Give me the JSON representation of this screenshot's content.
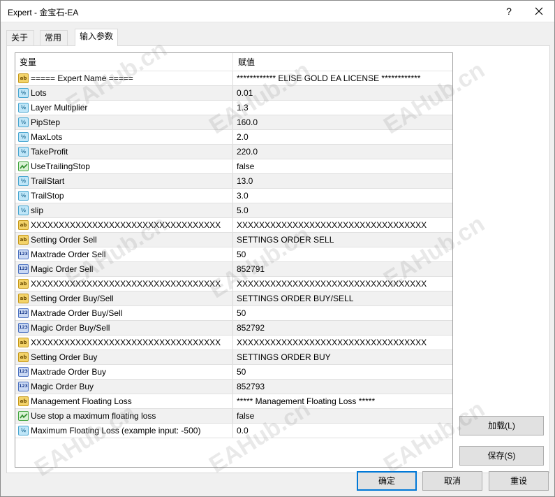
{
  "window": {
    "title": "Expert - 金宝石-EA",
    "help_glyph": "?"
  },
  "tabs": [
    {
      "label": "关于"
    },
    {
      "label": "常用"
    },
    {
      "label": "输入参数",
      "active": true
    }
  ],
  "grid": {
    "headers": {
      "variable": "变量",
      "value": "赋值"
    },
    "rows": [
      {
        "type": "ab",
        "icon": "string-type-icon",
        "name": "===== Expert Name =====",
        "value": "************ ELISE GOLD EA LICENSE ************"
      },
      {
        "type": "dbl",
        "icon": "double-type-icon",
        "name": "Lots",
        "value": "0.01"
      },
      {
        "type": "dbl",
        "icon": "double-type-icon",
        "name": "Layer Multiplier",
        "value": "1.3"
      },
      {
        "type": "dbl",
        "icon": "double-type-icon",
        "name": "PipStep",
        "value": "160.0"
      },
      {
        "type": "dbl",
        "icon": "double-type-icon",
        "name": "MaxLots",
        "value": "2.0"
      },
      {
        "type": "dbl",
        "icon": "double-type-icon",
        "name": "TakeProfit",
        "value": "220.0"
      },
      {
        "type": "bool",
        "icon": "bool-type-icon",
        "name": "UseTrailingStop",
        "value": "false"
      },
      {
        "type": "dbl",
        "icon": "double-type-icon",
        "name": "TrailStart",
        "value": "13.0"
      },
      {
        "type": "dbl",
        "icon": "double-type-icon",
        "name": "TrailStop",
        "value": "3.0"
      },
      {
        "type": "dbl",
        "icon": "double-type-icon",
        "name": "slip",
        "value": "5.0"
      },
      {
        "type": "ab",
        "icon": "string-type-icon",
        "name": "XXXXXXXXXXXXXXXXXXXXXXXXXXXXXXXXXX",
        "value": "XXXXXXXXXXXXXXXXXXXXXXXXXXXXXXXXXX"
      },
      {
        "type": "ab",
        "icon": "string-type-icon",
        "name": "Setting Order Sell",
        "value": "SETTINGS ORDER SELL"
      },
      {
        "type": "int",
        "icon": "integer-type-icon",
        "name": "Maxtrade Order Sell",
        "value": "50"
      },
      {
        "type": "int",
        "icon": "integer-type-icon",
        "name": "Magic Order Sell",
        "value": "852791"
      },
      {
        "type": "ab",
        "icon": "string-type-icon",
        "name": "XXXXXXXXXXXXXXXXXXXXXXXXXXXXXXXXXX",
        "value": "XXXXXXXXXXXXXXXXXXXXXXXXXXXXXXXXXX"
      },
      {
        "type": "ab",
        "icon": "string-type-icon",
        "name": "Setting Order Buy/Sell",
        "value": "SETTINGS ORDER BUY/SELL"
      },
      {
        "type": "int",
        "icon": "integer-type-icon",
        "name": "Maxtrade Order Buy/Sell",
        "value": "50"
      },
      {
        "type": "int",
        "icon": "integer-type-icon",
        "name": "Magic Order Buy/Sell",
        "value": "852792"
      },
      {
        "type": "ab",
        "icon": "string-type-icon",
        "name": "XXXXXXXXXXXXXXXXXXXXXXXXXXXXXXXXXX",
        "value": "XXXXXXXXXXXXXXXXXXXXXXXXXXXXXXXXXX"
      },
      {
        "type": "ab",
        "icon": "string-type-icon",
        "name": "Setting Order Buy",
        "value": "SETTINGS ORDER BUY"
      },
      {
        "type": "int",
        "icon": "integer-type-icon",
        "name": "Maxtrade Order Buy",
        "value": "50"
      },
      {
        "type": "int",
        "icon": "integer-type-icon",
        "name": "Magic Order Buy",
        "value": "852793"
      },
      {
        "type": "ab",
        "icon": "string-type-icon",
        "name": "Management Floating Loss",
        "value": "***** Management Floating Loss *****"
      },
      {
        "type": "bool",
        "icon": "bool-type-icon",
        "name": "Use stop a maximum floating loss",
        "value": "false"
      },
      {
        "type": "dbl",
        "icon": "double-type-icon",
        "name": "Maximum Floating Loss (example input: -500)",
        "value": "0.0"
      }
    ]
  },
  "icon_glyphs": {
    "ab": "ab",
    "dbl": "½",
    "int": "123"
  },
  "buttons": {
    "load": "加载(L)",
    "save": "保存(S)",
    "ok": "确定",
    "cancel": "取消",
    "reset": "重设"
  },
  "watermark_text": "EAHub.cn"
}
